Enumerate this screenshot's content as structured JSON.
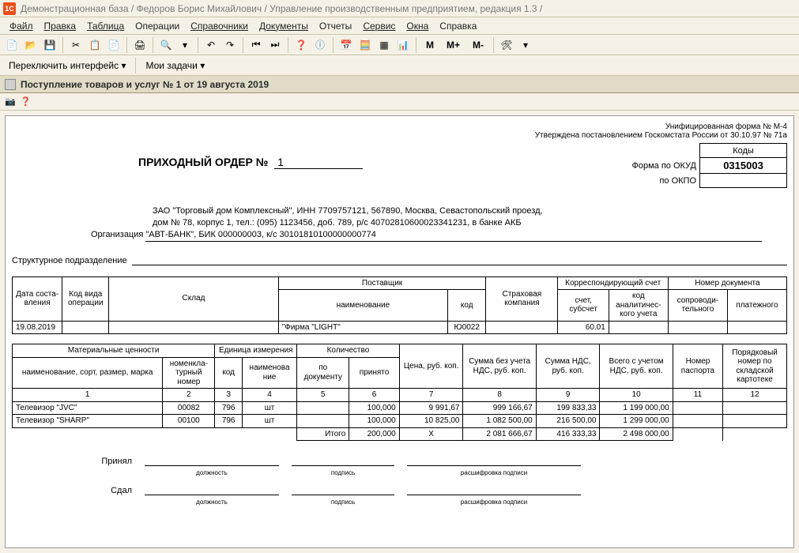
{
  "title": "Демонстрационная база / Федоров Борис Михайлович / Управление производственным предприятием, редакция 1.3 /",
  "menu": {
    "file": "Файл",
    "edit": "Правка",
    "table": "Таблица",
    "operations": "Операции",
    "catalogs": "Справочники",
    "documents": "Документы",
    "reports": "Отчеты",
    "service": "Сервис",
    "windows": "Окна",
    "help": "Справка"
  },
  "toolbar2": {
    "switch_interface": "Переключить интерфейс",
    "tasks": "Мои задачи"
  },
  "doc_tab": "Поступление товаров и услуг № 1 от 19 августа 2019",
  "doc": {
    "form_info1": "Унифицированная форма № М-4",
    "form_info2": "Утверждена постановлением Госкомстата России от 30.10.97 № 71а",
    "kody_label": "Коды",
    "okud_label": "Форма по ОКУД",
    "okud_value": "0315003",
    "okpo_label": "по ОКПО",
    "okpo_value": "",
    "main_title_prefix": "ПРИХОДНЫЙ ОРДЕР №",
    "main_title_num": "1",
    "org_line1": "ЗАО \"Торговый дом Комплексный\", ИНН 7709757121, 567890, Москва, Севастопольский проезд,",
    "org_line2": "дом № 78, корпус 1, тел.: (095) 1123456, доб. 789, р/с 40702810600023341231, в банке АКБ",
    "org_line3_label": "Организация",
    "org_line3_value": "\"АВТ-БАНК\", БИК 000000003, к/с 30101810100000000774",
    "struct_label": "Структурное подразделение",
    "struct_value": ""
  },
  "table1": {
    "headers": {
      "date": "Дата соста- вления",
      "op_code": "Код вида операции",
      "warehouse": "Склад",
      "supplier": "Поставщик",
      "supplier_name": "наименование",
      "supplier_code": "код",
      "insurance": "Страховая компания",
      "corr_acct": "Корреспондирующий счет",
      "acct_sub": "счет, субсчет",
      "acct_anal": "код аналитичес- кого учета",
      "doc_num": "Номер документа",
      "doc_accomp": "сопроводи- тельного",
      "doc_payment": "платежного"
    },
    "row": {
      "date": "19.08.2019",
      "op_code": "",
      "warehouse": "",
      "supplier_name": "\"Фирма \"LIGHT\"",
      "supplier_code": "Ю0022",
      "insurance": "",
      "acct_sub": "60.01",
      "acct_anal": "",
      "doc_accomp": "",
      "doc_payment": ""
    }
  },
  "table2": {
    "headers": {
      "matvalues": "Материальные ценности",
      "name_sort": "наименование, сорт, размер, марка",
      "nomencl": "номенкла- турный номер",
      "unit": "Единица измерения",
      "unit_code": "код",
      "unit_name": "наименова ние",
      "qty": "Количество",
      "qty_doc": "по документу",
      "qty_accepted": "принято",
      "price": "Цена, руб. коп.",
      "sum_no_vat": "Сумма без учета НДС, руб. коп.",
      "vat_sum": "Сумма НДС, руб. коп.",
      "total_vat": "Всего с учетом НДС, руб. коп.",
      "passport": "Номер паспорта",
      "card_num": "Порядковый номер по складской картотеке"
    },
    "col_nums": [
      "1",
      "2",
      "3",
      "4",
      "5",
      "6",
      "7",
      "8",
      "9",
      "10",
      "11",
      "12"
    ],
    "rows": [
      {
        "name": "Телевизор \"JVC\"",
        "nomencl": "00082",
        "unit_code": "796",
        "unit_name": "шт",
        "qty_doc": "",
        "qty_accepted": "100,000",
        "price": "9 991,67",
        "sum_no_vat": "999 166,67",
        "vat_sum": "199 833,33",
        "total_vat": "1 199 000,00",
        "passport": "",
        "card_num": ""
      },
      {
        "name": "Телевизор \"SHARP\"",
        "nomencl": "00100",
        "unit_code": "796",
        "unit_name": "шт",
        "qty_doc": "",
        "qty_accepted": "100,000",
        "price": "10 825,00",
        "sum_no_vat": "1 082 500,00",
        "vat_sum": "216 500,00",
        "total_vat": "1 299 000,00",
        "passport": "",
        "card_num": ""
      }
    ],
    "totals": {
      "label": "Итого",
      "qty_accepted": "200,000",
      "price": "Х",
      "sum_no_vat": "2 081 666,67",
      "vat_sum": "416 333,33",
      "total_vat": "2 498 000,00"
    }
  },
  "sign": {
    "received_label": "Принял",
    "delivered_label": "Сдал",
    "pos_cap": "должность",
    "sig_cap": "подпись",
    "name_cap": "расшифровка подписи"
  }
}
